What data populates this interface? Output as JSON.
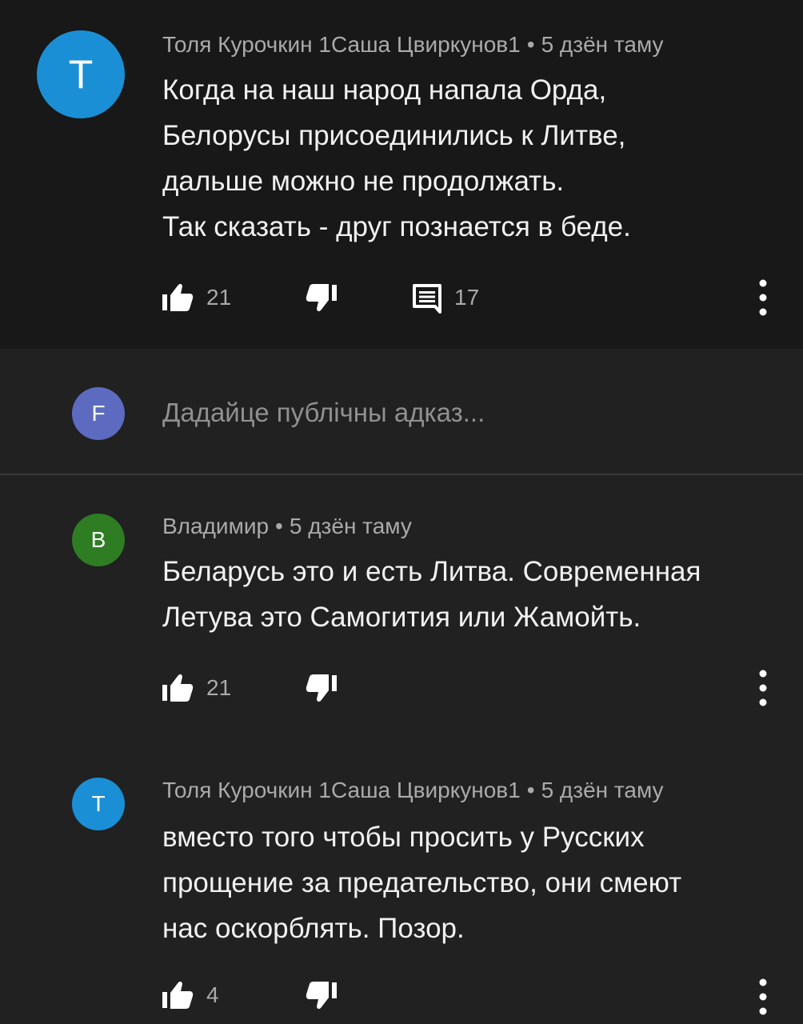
{
  "comment": {
    "avatar_letter": "T",
    "avatar_color": "#1a8fd6",
    "author": "Толя Курочкин 1Саша Цвиркунов1",
    "separator": "•",
    "time": "5 дзён таму",
    "lines": [
      "Когда на наш народ напала Орда,",
      "Белорусы присоединились к Литве,",
      "дальше можно не продолжать.",
      "Так сказать - друг познается в беде."
    ],
    "likes": "21",
    "replies_count": "17"
  },
  "reply_box": {
    "avatar_letter": "F",
    "avatar_color": "#5c6bc0",
    "placeholder": "Дадайце публічны адказ..."
  },
  "replies": [
    {
      "avatar_letter": "B",
      "avatar_color": "#2e7d23",
      "author": "Владимир",
      "separator": "•",
      "time": "5 дзён таму",
      "lines": [
        "Беларусь это и есть Литва. Современная",
        "Летува это Самогития или Жамойть."
      ],
      "likes": "21"
    },
    {
      "avatar_letter": "T",
      "avatar_color": "#1a8fd6",
      "author": "Толя Курочкин 1Саша Цвиркунов1",
      "separator": "•",
      "time": "5 дзён таму",
      "lines": [
        "вместо того чтобы просить у Русских",
        "прощение за предательство, они смеют",
        "нас оскорблять. Позор."
      ],
      "likes": "4"
    }
  ],
  "icons": {
    "like": "thumb-up-icon",
    "dislike": "thumb-down-icon",
    "reply": "comment-icon",
    "more": "more-vert-icon"
  }
}
